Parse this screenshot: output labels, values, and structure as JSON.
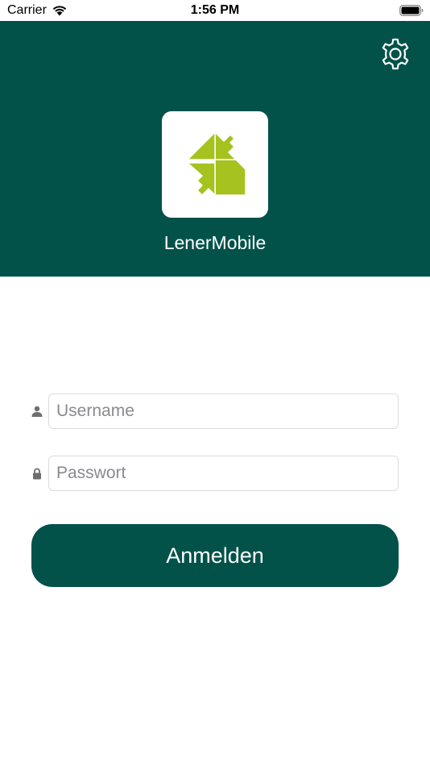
{
  "status_bar": {
    "carrier": "Carrier",
    "time": "1:56 PM"
  },
  "header": {
    "app_name": "LenerMobile",
    "background_color": "#02524a",
    "logo_color": "#a5c21f"
  },
  "icons": {
    "settings": "gear-icon",
    "username": "user-icon",
    "password": "lock-icon"
  },
  "form": {
    "username_placeholder": "Username",
    "username_value": "",
    "password_placeholder": "Passwort",
    "password_value": "",
    "login_label": "Anmelden"
  }
}
